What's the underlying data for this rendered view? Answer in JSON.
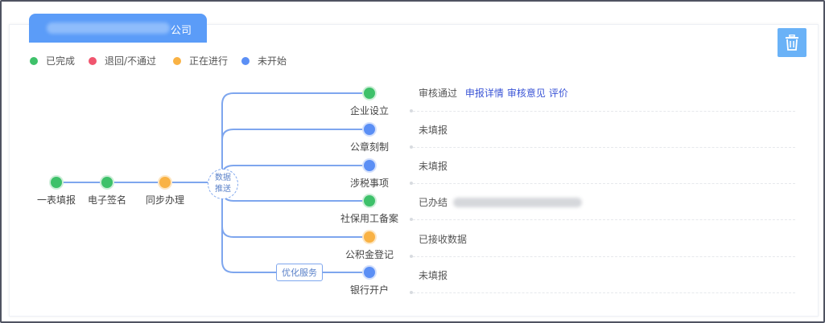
{
  "company": {
    "name_suffix": "公司"
  },
  "legend": [
    {
      "label": "已完成",
      "color": "#3ec16a"
    },
    {
      "label": "退回/不通过",
      "color": "#f0556e"
    },
    {
      "label": "正在进行",
      "color": "#f9b244"
    },
    {
      "label": "未开始",
      "color": "#5b8ff5"
    }
  ],
  "flow": {
    "steps": [
      {
        "label": "一表填报",
        "status": "completed"
      },
      {
        "label": "电子签名",
        "status": "completed"
      },
      {
        "label": "同步办理",
        "status": "in-progress"
      }
    ],
    "hub_label_1": "数据",
    "hub_label_2": "推送",
    "optimize_tag": "优化服务",
    "branches": [
      {
        "label": "企业设立",
        "status": "completed",
        "status_text": "审核通过",
        "links": [
          "申报详情",
          "审核意见",
          "评价"
        ]
      },
      {
        "label": "公章刻制",
        "status": "not-started",
        "status_text": "未填报"
      },
      {
        "label": "涉税事项",
        "status": "not-started",
        "status_text": "未填报"
      },
      {
        "label": "社保用工备案",
        "status": "completed",
        "status_text": "已办结"
      },
      {
        "label": "公积金登记",
        "status": "in-progress",
        "status_text": "已接收数据"
      },
      {
        "label": "银行开户",
        "status": "not-started",
        "status_text": "未填报"
      }
    ]
  },
  "colors": {
    "completed": "#3ec16a",
    "rejected": "#f0556e",
    "in-progress": "#f9b244",
    "not-started": "#5b8ff5",
    "line": "#7ea6ee",
    "link": "#3b55d6"
  },
  "icons": {
    "delete": "trash-icon"
  }
}
